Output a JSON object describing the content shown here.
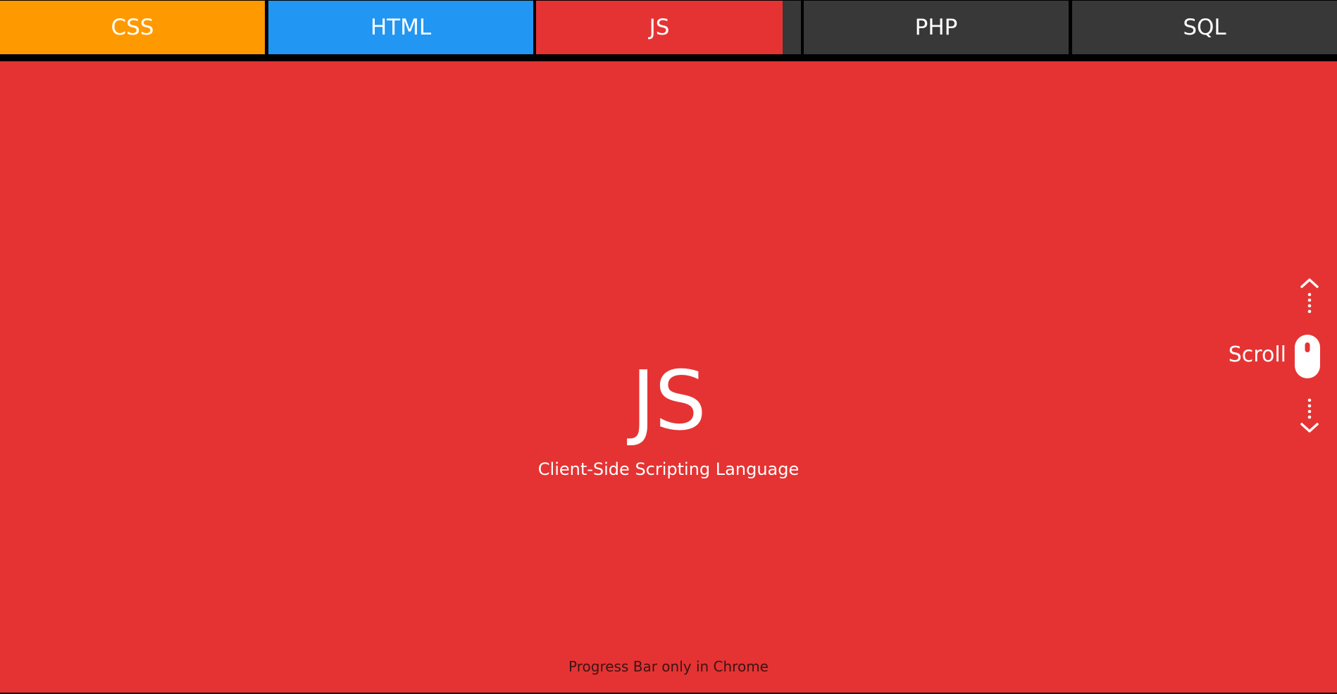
{
  "nav": {
    "tabs": [
      {
        "label": "CSS",
        "color": "#ff9900"
      },
      {
        "label": "HTML",
        "color": "#2196f3"
      },
      {
        "label": "JS",
        "color": "#e53333",
        "active": true,
        "progress": 0.92
      },
      {
        "label": "PHP",
        "color": "#383838"
      },
      {
        "label": "SQL",
        "color": "#383838"
      }
    ]
  },
  "hero": {
    "title": "JS",
    "subtitle": "Client-Side Scripting Language"
  },
  "scroll_hint": {
    "label": "Scroll",
    "up_icon": "chevron-up-icon",
    "down_icon": "chevron-down-icon",
    "mouse_icon": "mouse-icon"
  },
  "footer": {
    "note": "Progress Bar only in Chrome"
  },
  "colors": {
    "background": "#e53333",
    "nav_inactive": "#383838",
    "nav_border": "#000000",
    "text": "#ffffff",
    "footer_text": "#3b1414"
  }
}
